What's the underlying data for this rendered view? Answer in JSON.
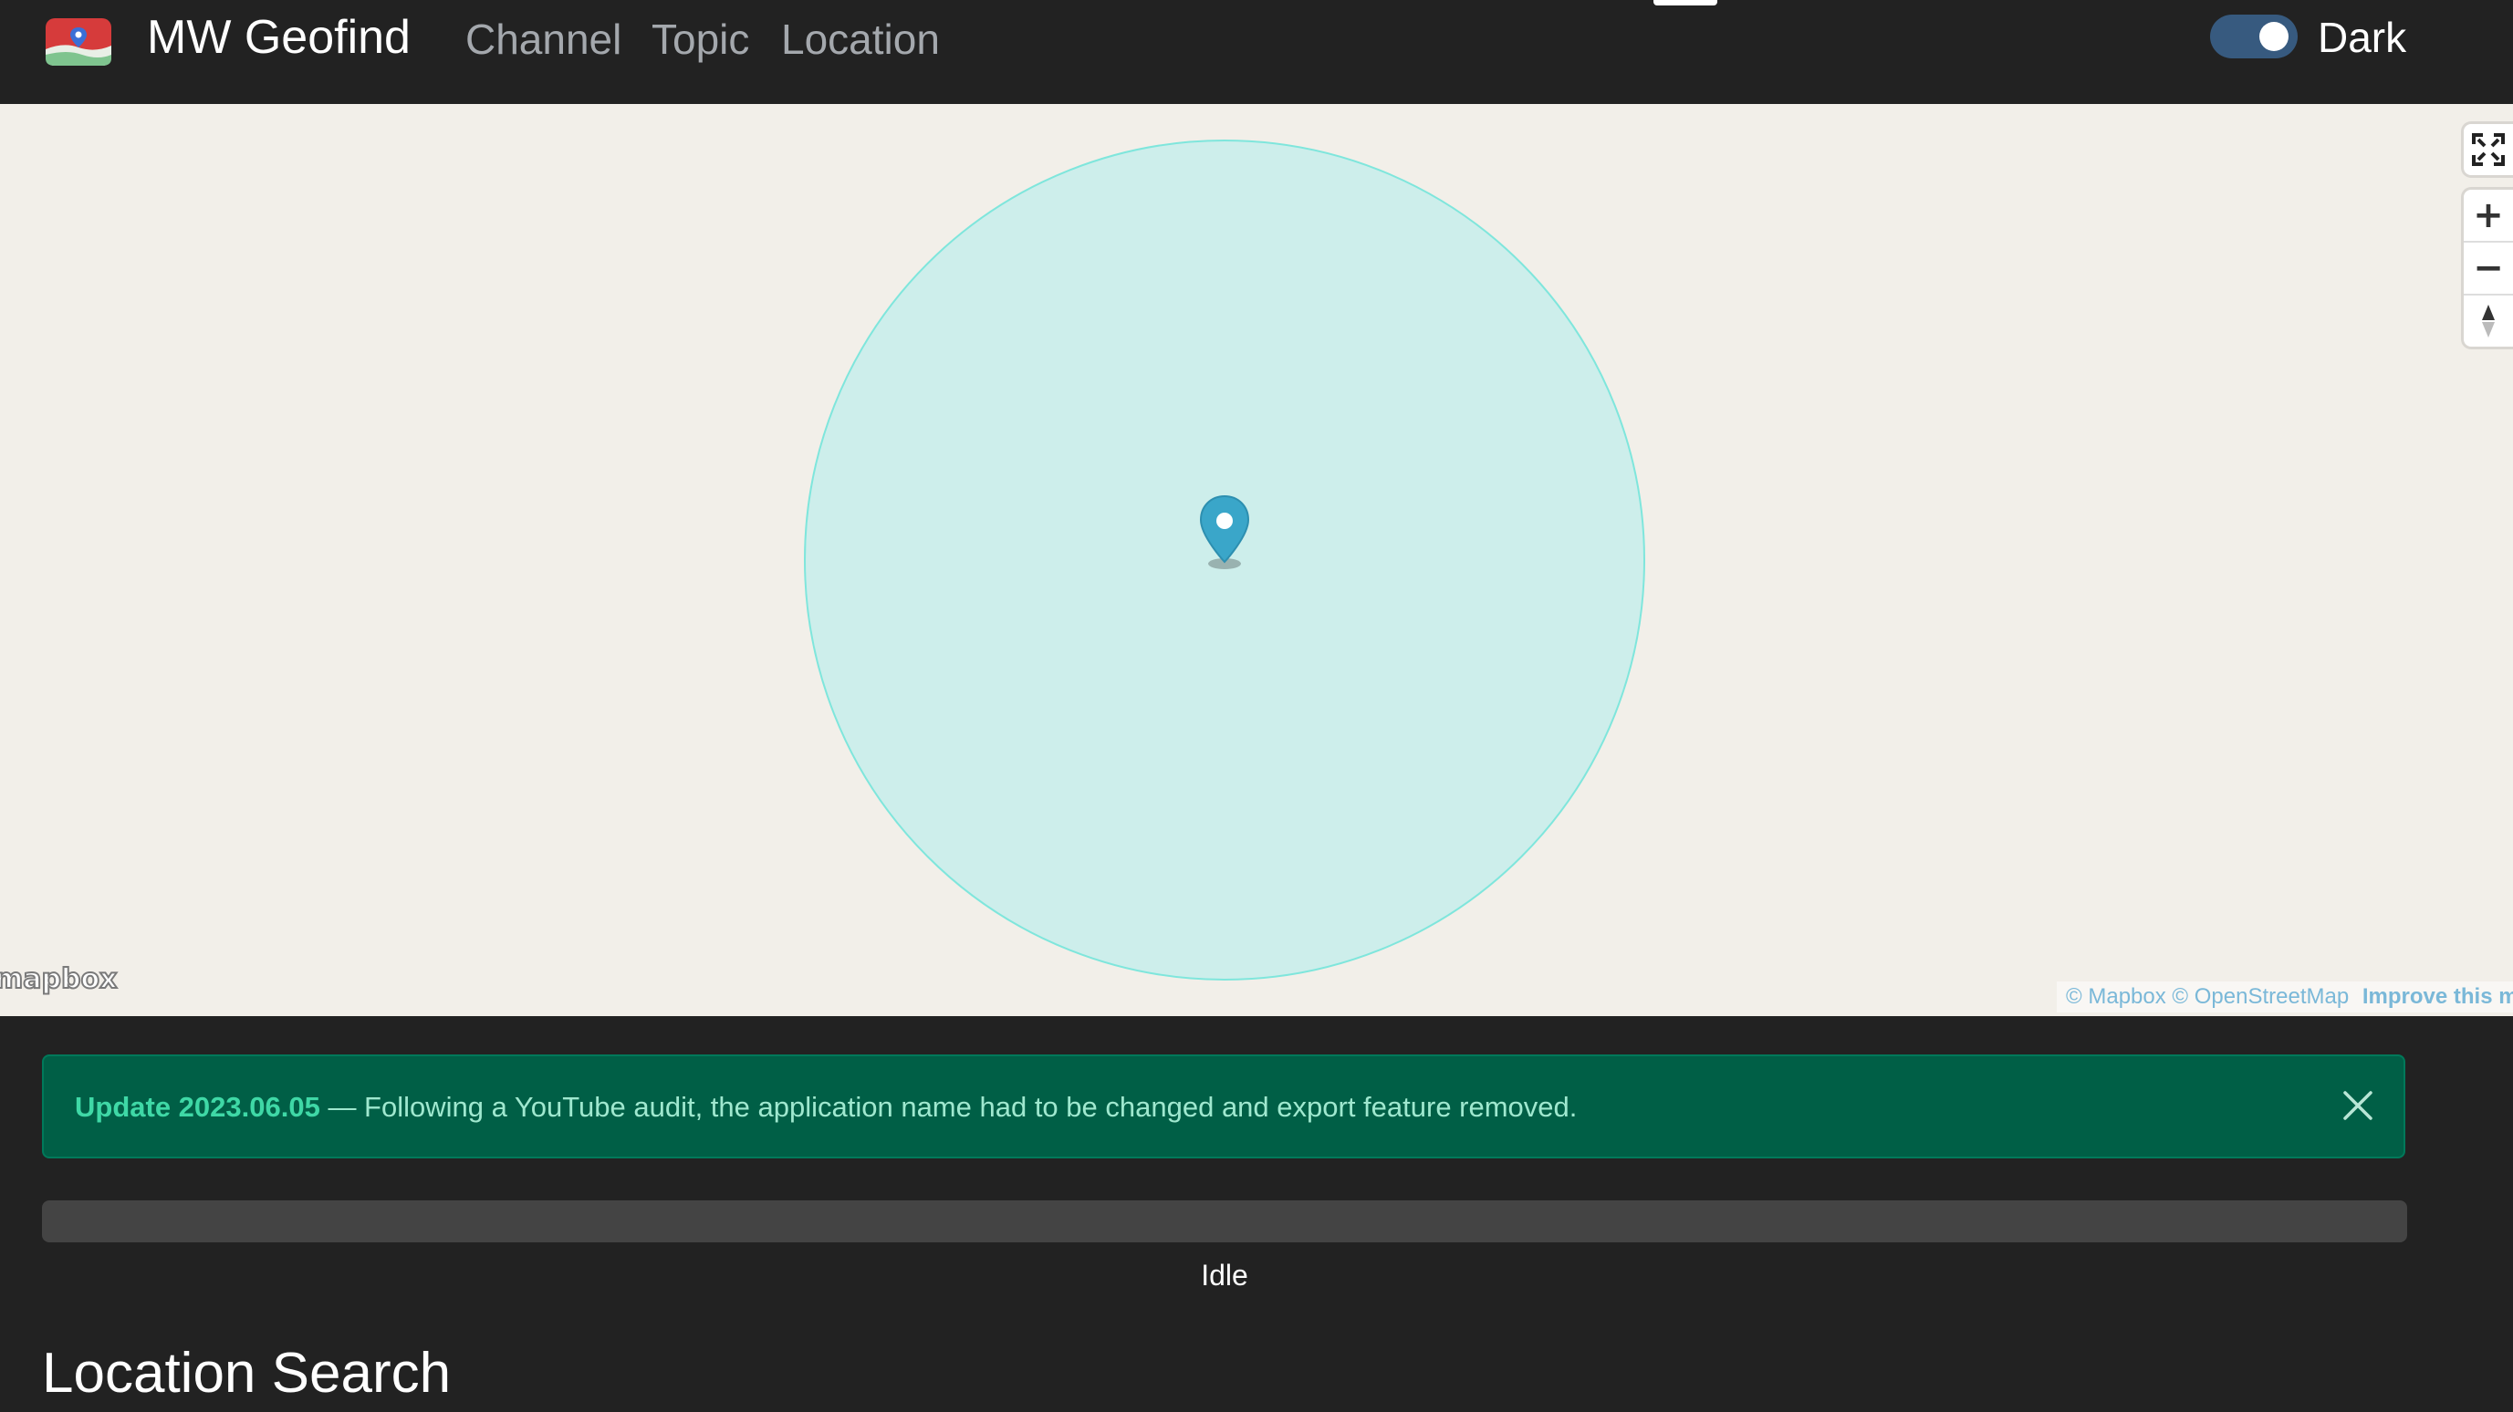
{
  "navbar": {
    "brand": "MW Geofind",
    "links": [
      "Channel",
      "Topic",
      "Location"
    ],
    "theme_label": "Dark",
    "theme_dark": true
  },
  "map": {
    "controls": {
      "fullscreen_icon": "fullscreen-icon",
      "zoom_in": "+",
      "zoom_out": "−",
      "compass_icon": "compass-icon"
    },
    "logo": "mapbox",
    "attribution": {
      "mapbox": "© Mapbox",
      "osm": "© OpenStreetMap",
      "improve": "Improve this map"
    },
    "radius_color": "#cdeeeb",
    "radius_stroke": "#7fe6dc",
    "marker_color": "#3aa6c9"
  },
  "alert": {
    "title": "Update 2023.06.05",
    "message": " — Following a YouTube audit, the application name had to be changed and export feature removed.",
    "bg_color": "#005f46"
  },
  "progress": {
    "value_fraction": 0,
    "status": "Idle"
  },
  "section": {
    "title": "Location Search"
  }
}
